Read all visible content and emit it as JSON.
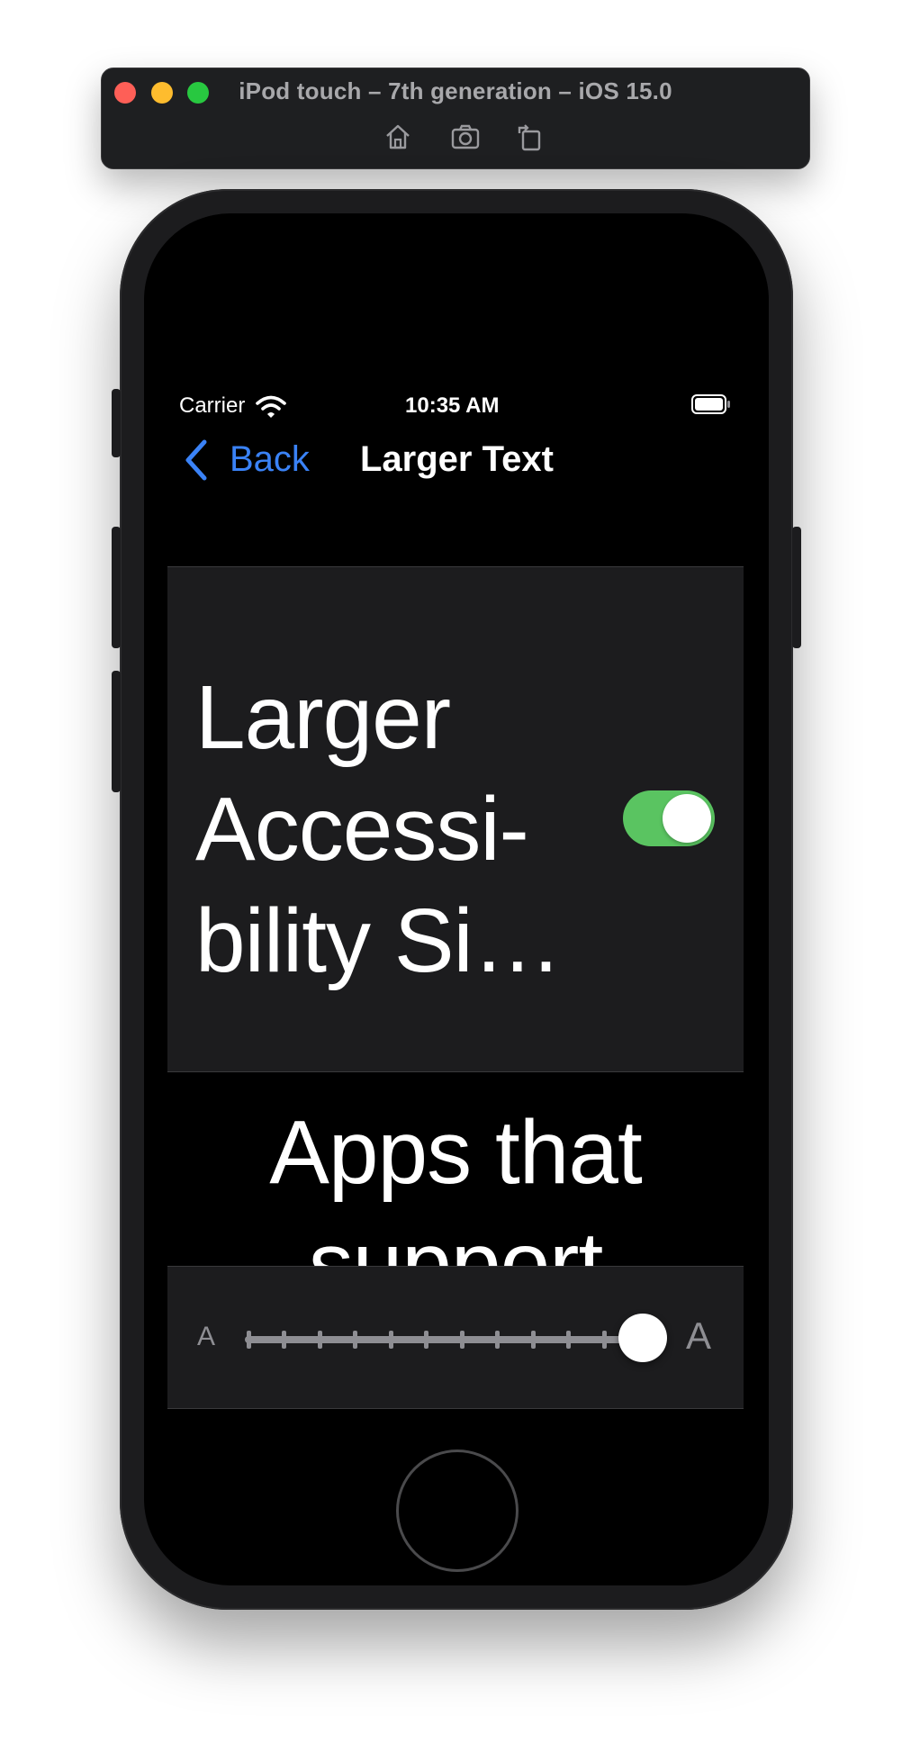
{
  "simulator": {
    "title": "iPod touch – 7th generation – iOS 15.0",
    "tools": [
      "home-icon",
      "screenshot-icon",
      "rotate-icon"
    ]
  },
  "status_bar": {
    "carrier": "Carrier",
    "time": "10:35 AM"
  },
  "nav": {
    "back_label": "Back",
    "title": "Larger Text"
  },
  "toggle_cell": {
    "label": "Larger\nAccessi-\nbility Si…",
    "enabled": true,
    "toggle_color": "#5ac461"
  },
  "footer": {
    "text": "Apps that support"
  },
  "slider": {
    "min_label": "A",
    "max_label": "A",
    "steps": 12,
    "value_fraction": 1.0
  },
  "colors": {
    "accent": "#3a82f6",
    "cell_background": "#1c1c1e",
    "secondary": "#8e8e93"
  }
}
